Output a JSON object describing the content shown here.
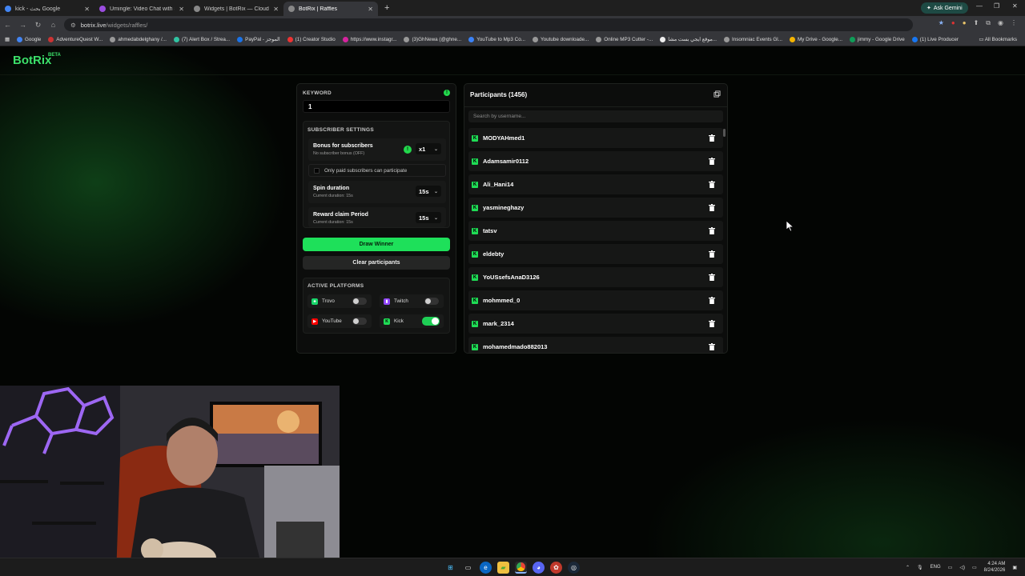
{
  "browser": {
    "tabs": [
      {
        "title": "kick - بحث Google",
        "icon_color": "#4285f4",
        "active": false
      },
      {
        "title": "Umingle: Video Chat with S...",
        "icon_color": "#9b4de0",
        "active": false
      },
      {
        "title": "Widgets | BotRix — Cloud Strea",
        "icon_color": "#888888",
        "active": false
      },
      {
        "title": "BotRix | Raffles",
        "icon_color": "#888888",
        "active": true
      }
    ],
    "new_tab_label": "+",
    "ask_gemini_label": "Ask Gemini",
    "url_domain": "botrix.live",
    "url_path": "/widgets/raffles/",
    "bookmarks": [
      "Google",
      "AdventureQuest W...",
      "ahmedabdelghany /...",
      "(7) Alert Box / Strea...",
      "PayPal - الموجز",
      "(1) Creator Studio",
      "https://www.instagr...",
      "(3)GhNewa (@ghne...",
      "YouTube to Mp3 Co...",
      "Youtube downloade...",
      "Online MP3 Cutter -...",
      "موقع ايجي بست مشا...",
      "Insomniac Events Gl...",
      "My Drive - Google...",
      "jimmy - Google Drive",
      "(1) Live Producer"
    ],
    "all_bookmarks_label": "All Bookmarks"
  },
  "site": {
    "logo": "BotRix",
    "logo_badge": "BETA",
    "accent": "#1ee05a"
  },
  "raffle": {
    "keyword_label": "KEYWORD",
    "keyword_value": "1",
    "subscriber_settings_label": "SUBSCRIBER SETTINGS",
    "bonus_title": "Bonus for subscribers",
    "bonus_sub": "No subscriber bonus (OFF)",
    "bonus_value": "x1",
    "paid_only_label": "Only paid subscribers can participate",
    "spin_title": "Spin duration",
    "spin_sub": "Current duration: 15s",
    "spin_value": "15s",
    "claim_title": "Reward claim Period",
    "claim_sub": "Current duration: 15s",
    "claim_value": "15s",
    "draw_button": "Draw Winner",
    "clear_button": "Clear participants",
    "platforms_label": "ACTIVE PLATFORMS",
    "platforms": [
      {
        "name": "Trovo",
        "enabled": false
      },
      {
        "name": "Twitch",
        "enabled": false
      },
      {
        "name": "YouTube",
        "enabled": false
      },
      {
        "name": "Kick",
        "enabled": true
      }
    ]
  },
  "participants": {
    "title": "Participants (1456)",
    "search_placeholder": "Search by username...",
    "users": [
      "MODYAHmed1",
      "Adamsamir0112",
      "Ali_Hani14",
      "yasmineghazy",
      "tatsv",
      "eldebty",
      "YoUSsefsAnaD3126",
      "mohmmed_0",
      "mark_2314",
      "mohamedmado882013"
    ]
  },
  "taskbar": {
    "lang": "ENG",
    "time": "4:24 AM",
    "date": "8/24/2026"
  }
}
